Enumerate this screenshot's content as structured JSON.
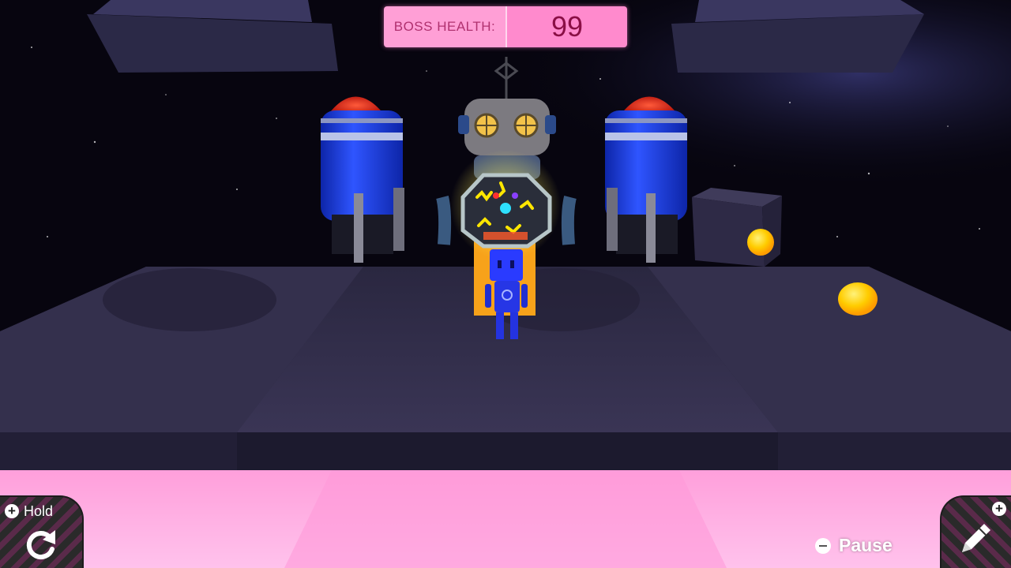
{
  "hud": {
    "boss_health_label": "BOSS HEALTH:",
    "boss_health_value": "99"
  },
  "controls": {
    "hold_label": "Hold",
    "hold_icon": "rotate-icon",
    "draw_icon": "pencil-icon",
    "pause_label": "Pause"
  },
  "colors": {
    "hud_pink": "#ff8acd",
    "floor_pink": "#ffb3e6",
    "player_blue": "#2a3bff",
    "coin_yellow": "#ffd400",
    "rocket_blue": "#1e3fd8",
    "rocket_cap_red": "#e01200"
  }
}
